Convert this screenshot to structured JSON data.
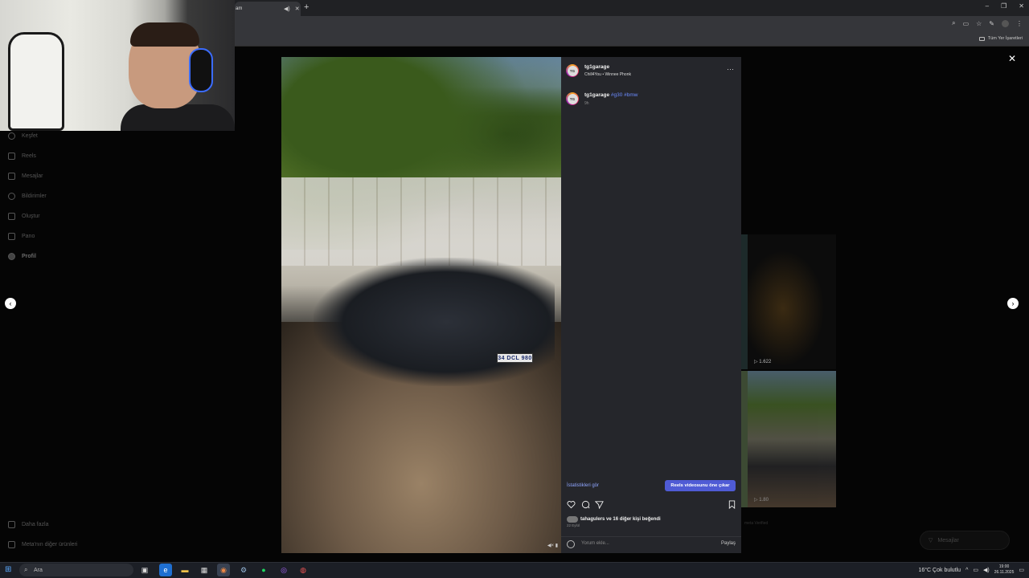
{
  "browser": {
    "tab_title": "am",
    "new_tab": "+",
    "window_controls": {
      "minimize": "–",
      "maximize": "❐",
      "close": "✕"
    },
    "bookmarks_label": "Tüm Yer İşaretleri"
  },
  "sidebar": {
    "items": [
      {
        "label": "Keşfet"
      },
      {
        "label": "Reels"
      },
      {
        "label": "Mesajlar"
      },
      {
        "label": "Bildirimler"
      },
      {
        "label": "Oluştur"
      },
      {
        "label": "Pano"
      },
      {
        "label": "Profil"
      }
    ],
    "more": "Daha fazla",
    "meta": "Meta'nın diğer ürünleri"
  },
  "post": {
    "username": "tg1garage",
    "avatar_text": "TG",
    "audio": "Chill4You • Winnee Phonk",
    "caption_user": "tg1garage",
    "caption_tags": "#g30 #bmw",
    "caption_time": "9h",
    "plate": "34 DCL 980",
    "stats_link": "İstatistikleri gör",
    "promote_button": "Reels videosunu öne çıkar",
    "likes_text": "tahagulers ve 16 diğer kişi beğendi",
    "date": "22 Eylül",
    "comment_placeholder": "Yorum ekle...",
    "share_label": "Paylaş"
  },
  "grid": {
    "views_1": "1.622",
    "views_2": "1.80",
    "footer": "meta Verified"
  },
  "messages_pill": "Mesajlar",
  "taskbar": {
    "search_placeholder": "Ara",
    "weather": "16°C  Çok bulutlu",
    "time": "19:00",
    "date": "26.11.2025"
  },
  "colors": {
    "accent_button": "#4f5bd5",
    "link": "#8fa6ff",
    "panel_bg": "#25262b"
  }
}
